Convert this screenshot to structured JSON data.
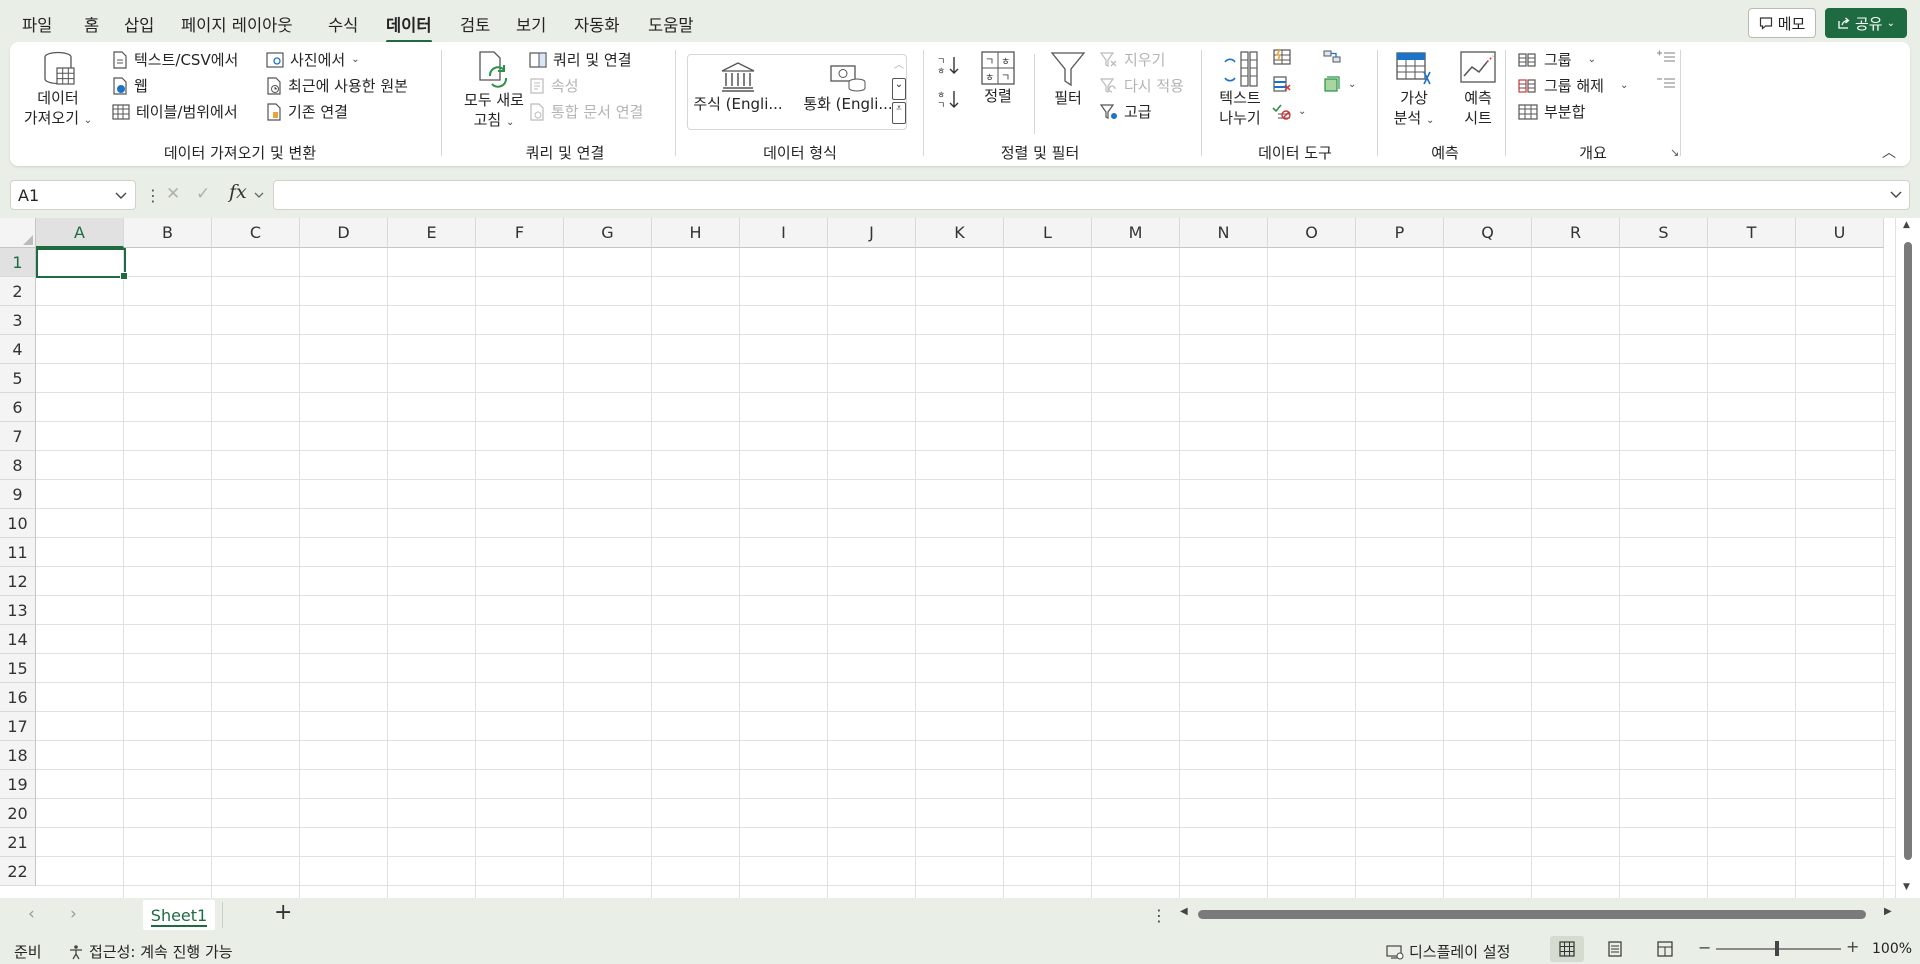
{
  "tabs": [
    "파일",
    "홈",
    "삽입",
    "페이지 레이아웃",
    "수식",
    "데이터",
    "검토",
    "보기",
    "자동화",
    "도움말"
  ],
  "active_tab": "데이터",
  "header_buttons": {
    "memo": "메모",
    "share": "공유"
  },
  "ribbon": {
    "get_data": {
      "get_data_line1": "데이터",
      "get_data_line2": "가져오기",
      "from_text_csv": "텍스트/CSV에서",
      "from_web": "웹",
      "from_table_range": "테이블/범위에서",
      "from_picture": "사진에서",
      "recent_sources": "최근에 사용한 원본",
      "existing_connections": "기존 연결",
      "group_label": "데이터 가져오기 및 변환"
    },
    "queries": {
      "refresh_all_line1": "모두 새로",
      "refresh_all_line2": "고침",
      "queries_connections": "쿼리 및 연결",
      "properties": "속성",
      "edit_links": "통합 문서 연결",
      "group_label": "쿼리 및 연결"
    },
    "data_types": {
      "stocks": "주식 (Engli...",
      "currencies": "통화 (Engli...",
      "group_label": "데이터 형식"
    },
    "sort_filter": {
      "sort": "정렬",
      "filter": "필터",
      "clear": "지우기",
      "reapply": "다시 적용",
      "advanced": "고급",
      "group_label": "정렬 및 필터"
    },
    "data_tools": {
      "text_to_columns_line1": "텍스트",
      "text_to_columns_line2": "나누기",
      "group_label": "데이터 도구"
    },
    "forecast": {
      "what_if_line1": "가상",
      "what_if_line2": "분석",
      "forecast_sheet_line1": "예측",
      "forecast_sheet_line2": "시트",
      "group_label": "예측"
    },
    "outline": {
      "group": "그룹",
      "ungroup": "그룹 해제",
      "subtotal": "부분합",
      "group_label": "개요"
    }
  },
  "formula_bar": {
    "name_box": "A1",
    "fx": "fx",
    "formula": ""
  },
  "grid": {
    "columns": [
      "A",
      "B",
      "C",
      "D",
      "E",
      "F",
      "G",
      "H",
      "I",
      "J",
      "K",
      "L",
      "M",
      "N",
      "O",
      "P",
      "Q",
      "R",
      "S",
      "T",
      "U"
    ],
    "rows": [
      "1",
      "2",
      "3",
      "4",
      "5",
      "6",
      "7",
      "8",
      "9",
      "10",
      "11",
      "12",
      "13",
      "14",
      "15",
      "16",
      "17",
      "18",
      "19",
      "20",
      "21",
      "22"
    ],
    "active_cell": "A1"
  },
  "sheets": {
    "tabs": [
      "Sheet1"
    ],
    "active": "Sheet1",
    "add_label": "+"
  },
  "status_bar": {
    "ready": "준비",
    "accessibility": "접근성: 계속 진행 가능",
    "display_settings": "디스플레이 설정",
    "zoom": "100%"
  },
  "colors": {
    "accent": "#1e6b41",
    "background": "#e9efe6"
  }
}
